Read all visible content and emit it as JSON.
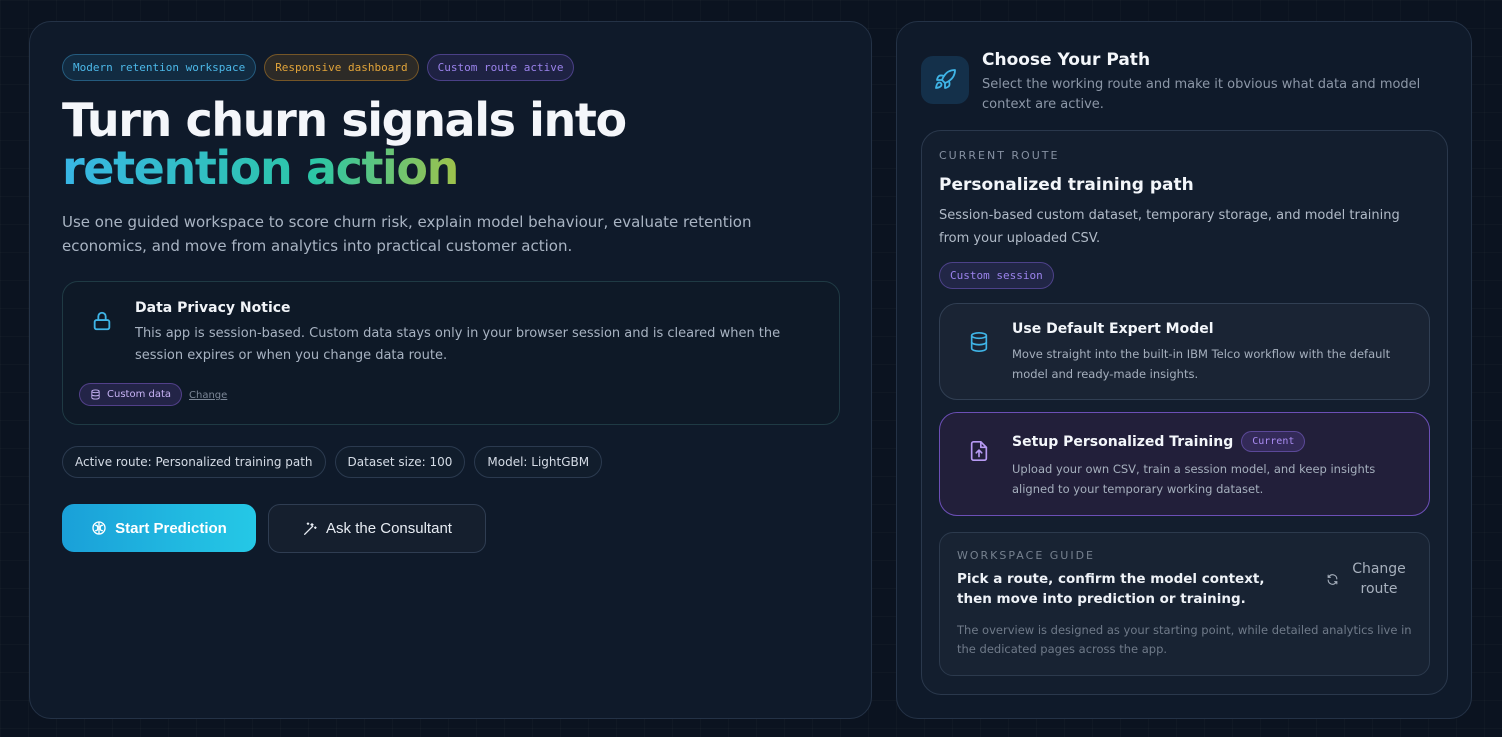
{
  "hero": {
    "tags": [
      "Modern retention workspace",
      "Responsive dashboard",
      "Custom route active"
    ],
    "title_line1": "Turn churn signals into",
    "title_line2": "retention action",
    "subtitle": "Use one guided workspace to score churn risk, explain model behaviour, evaluate retention economics, and move from analytics into practical customer action."
  },
  "privacy_notice": {
    "icon": "lock-icon",
    "title": "Data Privacy Notice",
    "body": "This app is session-based. Custom data stays only in your browser session and is cleared when the session expires or when you change data route.",
    "chip_label": "Custom data",
    "change_label": "Change"
  },
  "status_pills": [
    "Active route: Personalized training path",
    "Dataset size: 100",
    "Model: LightGBM"
  ],
  "actions": {
    "primary_label": "Start Prediction",
    "secondary_label": "Ask the Consultant"
  },
  "path_panel": {
    "icon": "rocket-icon",
    "title": "Choose Your Path",
    "subtitle": "Select the working route and make it obvious what data and model context are active.",
    "current_route": {
      "eyebrow": "CURRENT ROUTE",
      "title": "Personalized training path",
      "description": "Session-based custom dataset, temporary storage, and model training from your uploaded CSV.",
      "chip": "Custom session"
    },
    "options": [
      {
        "icon": "database-icon",
        "title": "Use Default Expert Model",
        "description": "Move straight into the built-in IBM Telco workflow with the default model and ready-made insights."
      },
      {
        "icon": "upload-file-icon",
        "title": "Setup Personalized Training",
        "badge": "Current",
        "description": "Upload your own CSV, train a session model, and keep insights aligned to your temporary working dataset."
      }
    ],
    "guide": {
      "eyebrow": "WORKSPACE GUIDE",
      "title": "Pick a route, confirm the model context, then move into prediction or training.",
      "change_label": "Change route",
      "note": "The overview is designed as your starting point, while detailed analytics live in the dedicated pages across the app."
    }
  },
  "colors": {
    "accent_cyan": "#25c8e6",
    "accent_purple": "#6c4fb6",
    "gradient": [
      "#38b6e6",
      "#2cc6a6",
      "#a7c244",
      "#e0a630"
    ]
  }
}
